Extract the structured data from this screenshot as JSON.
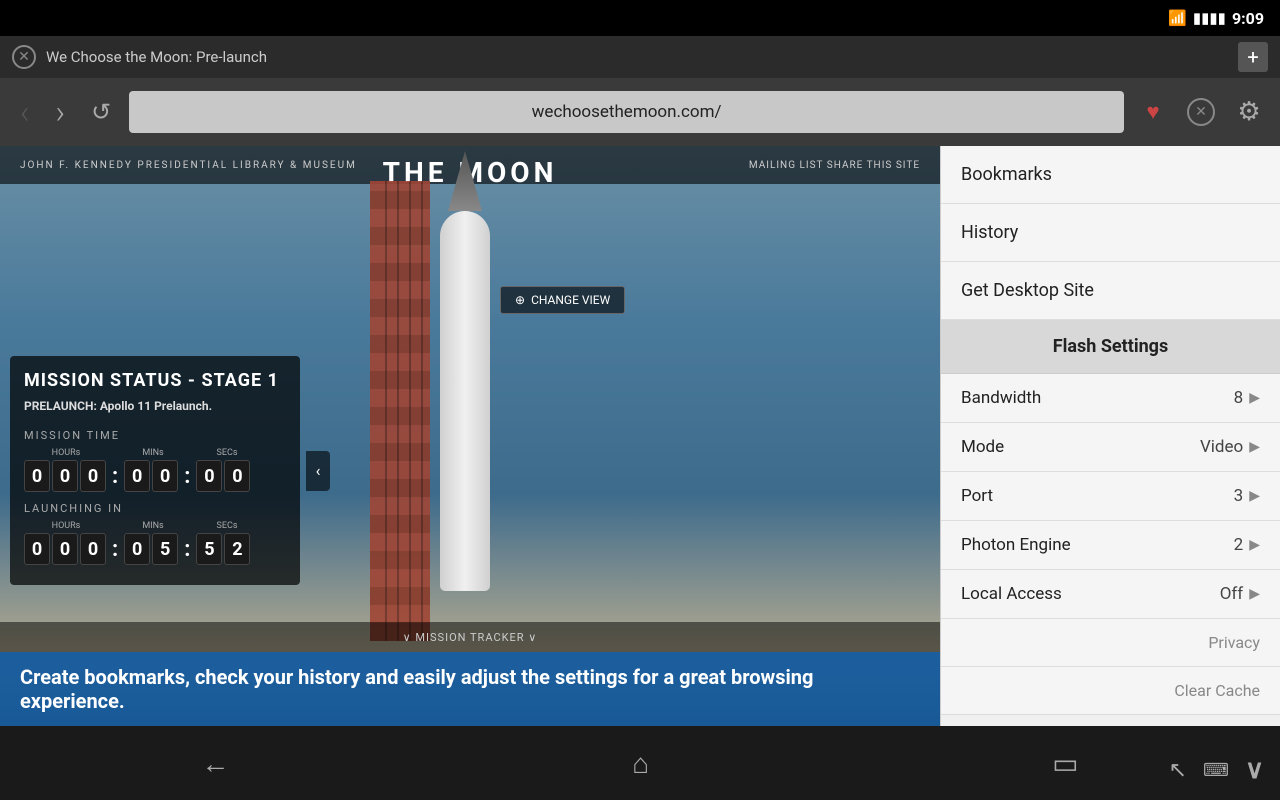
{
  "statusBar": {
    "time": "9:09",
    "wifi": "📶",
    "battery": "🔋"
  },
  "titleBar": {
    "closeLabel": "✕",
    "tabTitle": "We Choose the Moon: Pre-launch",
    "newTabIcon": "+"
  },
  "navBar": {
    "backIcon": "‹",
    "forwardIcon": "›",
    "refreshIcon": "↺",
    "url": "wechoosethemoon.com/",
    "favoriteIcon": "♥",
    "stopIcon": "⊗",
    "settingsIcon": "⚙"
  },
  "websiteContent": {
    "headerLeft": "JOHN F. KENNEDY  PRESIDENTIAL LIBRARY & MUSEUM",
    "headerRight": "MAILING LIST    SHARE THIS SITE",
    "moonTitle": "THE MOON",
    "changeViewLabel": "⊕  CHANGE VIEW",
    "missionPanel": {
      "title": "MISSION STATUS  -  STAGE 1",
      "prelaunchLabel": "PRELAUNCH:",
      "prelaunchValue": "Apollo 11 Prelaunch.",
      "missionTimeLabel": "MISSION TIME",
      "hours": [
        "0",
        "0",
        "0"
      ],
      "minsLabel": "MINs",
      "hoursLabel": "HOURs",
      "secsLabel": "SECs",
      "timeColon1": ":",
      "timeColon2": ":",
      "mins": [
        "0",
        "0"
      ],
      "secs": [
        "0",
        "0"
      ],
      "launchingInLabel": "LAUNCHING IN",
      "launchHours": [
        "0",
        "0",
        "0"
      ],
      "launchMins": [
        "0",
        "5"
      ],
      "launchSecs": [
        "5",
        "2"
      ]
    },
    "missionTrackerLabel": "∨  MISSION TRACKER  ∨",
    "bannerText": "Create bookmarks, check your history and easily adjust the settings for a great browsing experience."
  },
  "dropdownMenu": {
    "bookmarksLabel": "Bookmarks",
    "historyLabel": "History",
    "desktopSiteLabel": "Get Desktop Site",
    "flashSettingsLabel": "Flash Settings",
    "settings": [
      {
        "label": "Bandwidth",
        "value": "8"
      },
      {
        "label": "Mode",
        "value": "Video"
      },
      {
        "label": "Port",
        "value": "3"
      },
      {
        "label": "Photon Engine",
        "value": "2"
      },
      {
        "label": "Local Access",
        "value": "Off"
      }
    ],
    "privacyLabel": "Privacy",
    "clearCacheLabel": "Clear Cache"
  },
  "bottomNav": {
    "backIcon": "←",
    "homeIcon": "⌂",
    "recentIcon": "▭"
  },
  "bottomRightIcons": {
    "cursorIcon": "↖",
    "keyboardIcon": "⌨",
    "chevronDownIcon": "∨"
  }
}
